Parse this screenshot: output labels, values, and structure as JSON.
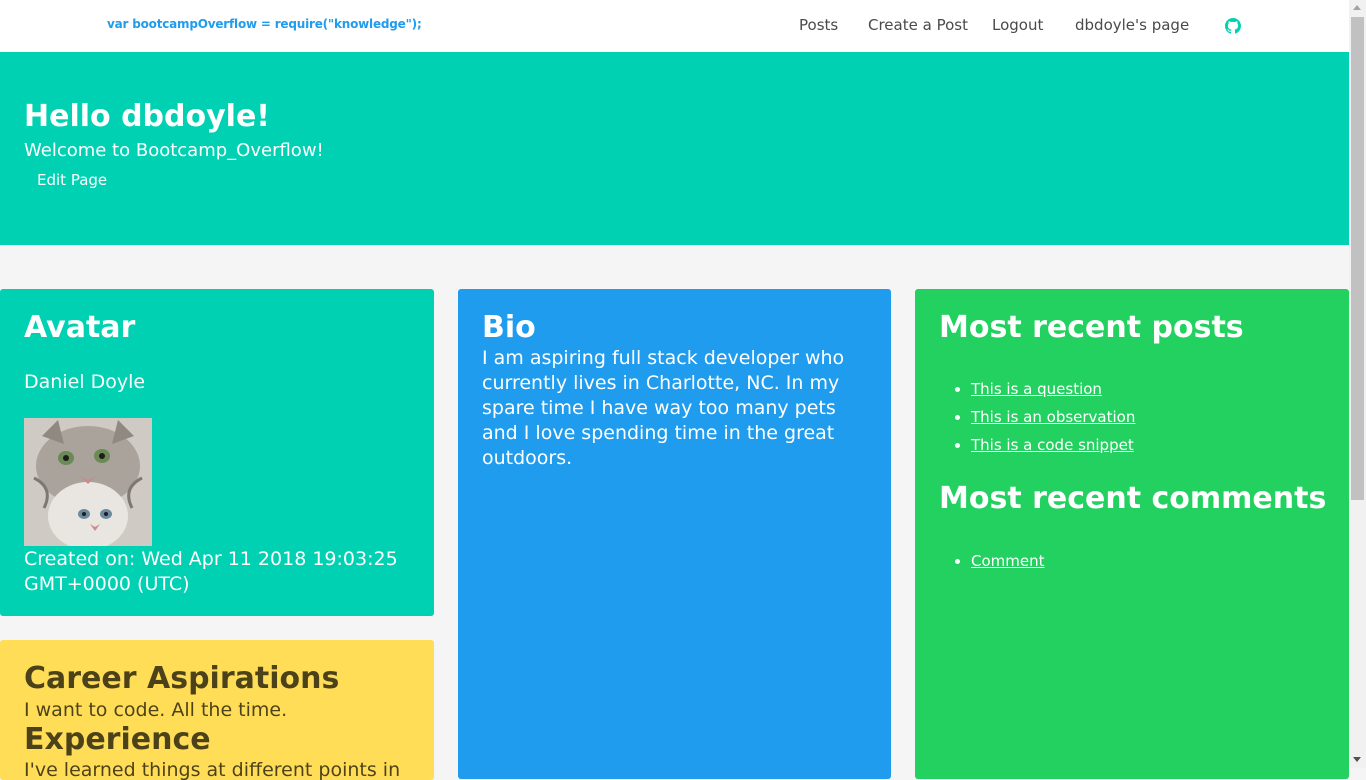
{
  "navbar": {
    "brand": "var bootcampOverflow = require(\"knowledge\");",
    "items": [
      {
        "label": "Posts"
      },
      {
        "label": "Create a Post"
      },
      {
        "label": "Logout"
      },
      {
        "label": "dbdoyle's page"
      }
    ],
    "github_icon": "github-icon"
  },
  "hero": {
    "title": "Hello dbdoyle!",
    "subtitle": "Welcome to Bootcamp_Overflow!",
    "edit_link": "Edit Page"
  },
  "avatar_card": {
    "title": "Avatar",
    "name": "Daniel Doyle",
    "image_icon": "cat-avatar-image",
    "created": "Created on: Wed Apr 11 2018 19:03:25 GMT+0000 (UTC)"
  },
  "career_card": {
    "title": "Career Aspirations",
    "text": "I want to code. All the time.",
    "experience_title": "Experience",
    "experience_text": "I've learned things at different points in"
  },
  "bio_card": {
    "title": "Bio",
    "text": "I am aspiring full stack developer who currently lives in Charlotte, NC. In my spare time I have way too many pets and I love spending time in the great outdoors."
  },
  "posts_card": {
    "posts_title": "Most recent posts",
    "posts": [
      {
        "label": "This is a question"
      },
      {
        "label": "This is an observation"
      },
      {
        "label": "This is a code snippet"
      }
    ],
    "comments_title": "Most recent comments",
    "comments": [
      {
        "label": "Comment"
      }
    ]
  },
  "colors": {
    "primary": "#00d1b2",
    "info": "#209cee",
    "success": "#23d160",
    "warning": "#ffdd57",
    "brand_text": "#209cee"
  }
}
